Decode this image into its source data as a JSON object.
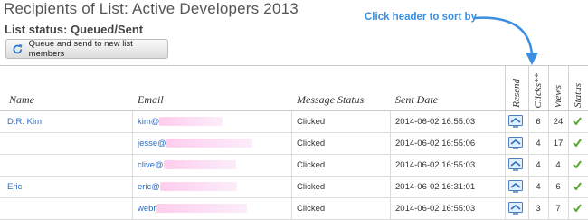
{
  "page": {
    "title": "Recipients of List: Active Developers 2013",
    "status_label": "List status: Queued/Sent",
    "queue_button_label": "Queue and send to new list members",
    "annotation": "Click header to sort by"
  },
  "table": {
    "headers": {
      "name": "Name",
      "email": "Email",
      "message_status": "Message Status",
      "sent_date": "Sent Date",
      "resend": "Resend",
      "clicks": "Clicks**",
      "views": "Views",
      "status": "Status"
    },
    "rows": [
      {
        "name": "D.R. Kim",
        "email": "kim@",
        "message_status": "Clicked",
        "sent_date": "2014-06-02 16:55:03",
        "clicks": "6",
        "views": "24"
      },
      {
        "name": "",
        "email": "jesse@",
        "message_status": "Clicked",
        "sent_date": "2014-06-02 16:55:06",
        "clicks": "4",
        "views": "17"
      },
      {
        "name": "",
        "email": "clive@",
        "message_status": "Clicked",
        "sent_date": "2014-06-02 16:55:03",
        "clicks": "4",
        "views": "4"
      },
      {
        "name": "Eric",
        "email": "eric@",
        "message_status": "Clicked",
        "sent_date": "2014-06-02 16:31:01",
        "clicks": "4",
        "views": "6"
      },
      {
        "name": "",
        "email": "webr",
        "message_status": "Clicked",
        "sent_date": "2014-06-02 16:55:03",
        "clicks": "3",
        "views": "7"
      }
    ]
  },
  "icons": {
    "queue": "refresh-icon",
    "resend": "resend-icon",
    "status": "checkmark-icon",
    "annotation": "curved-arrow-icon"
  },
  "colors": {
    "link": "#2b6cc4",
    "annotation": "#3b8fe0",
    "check": "#5aa832"
  }
}
